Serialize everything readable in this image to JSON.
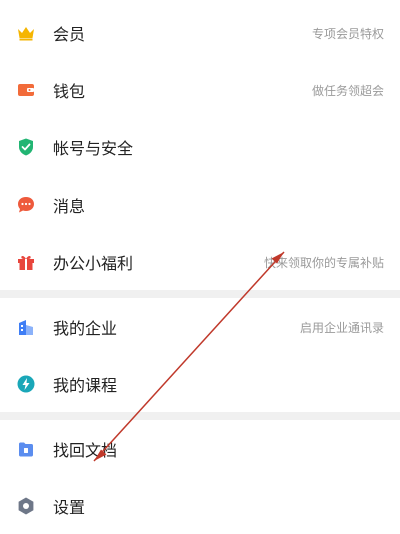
{
  "menu": {
    "items": [
      {
        "label": "会员",
        "desc": "专项会员特权",
        "icon": "crown-icon",
        "color": "#f5b500"
      },
      {
        "label": "钱包",
        "desc": "做任务领超会",
        "icon": "wallet-icon",
        "color": "#f26b3a"
      },
      {
        "label": "帐号与安全",
        "desc": "",
        "icon": "shield-icon",
        "color": "#22b573"
      },
      {
        "label": "消息",
        "desc": "",
        "icon": "chat-icon",
        "color": "#ee5a3c"
      },
      {
        "label": "办公小福利",
        "desc": "快来领取你的专属补贴",
        "icon": "gift-icon",
        "color": "#e8453c"
      },
      {
        "label": "我的企业",
        "desc": "启用企业通讯录",
        "icon": "enterprise-icon",
        "color": "#3f7ef5"
      },
      {
        "label": "我的课程",
        "desc": "",
        "icon": "course-icon",
        "color": "#1aa7b8"
      },
      {
        "label": "找回文档",
        "desc": "",
        "icon": "recover-doc-icon",
        "color": "#5b8def"
      },
      {
        "label": "设置",
        "desc": "",
        "icon": "settings-icon",
        "color": "#6e7788"
      }
    ]
  },
  "colors": {
    "divider": "#f0f0f0",
    "annotation_arrow": "#c0392b"
  }
}
